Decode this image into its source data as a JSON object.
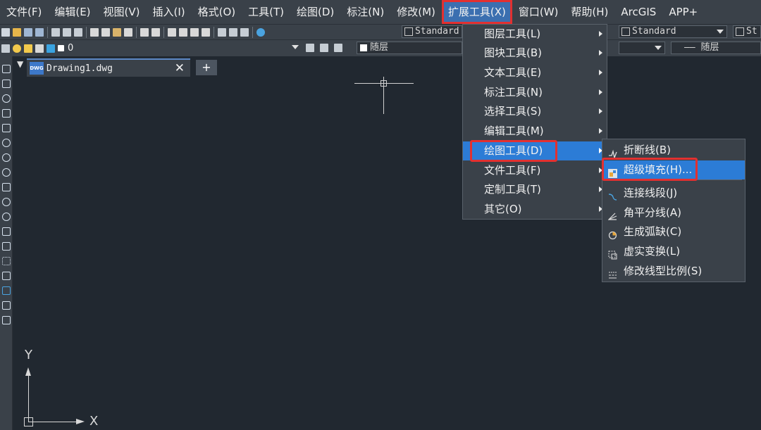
{
  "menubar": {
    "items": [
      "文件(F)",
      "编辑(E)",
      "视图(V)",
      "插入(I)",
      "格式(O)",
      "工具(T)",
      "绘图(D)",
      "标注(N)",
      "修改(M)",
      "扩展工具(X)",
      "窗口(W)",
      "帮助(H)",
      "ArcGIS",
      "APP+"
    ]
  },
  "toolbar": {
    "text_style": "Standard",
    "dim_style": "Standard",
    "dim_style_truncated": "St",
    "layer_value": "0",
    "color_value": "随层",
    "linetype_value": "—— 随层"
  },
  "document": {
    "tab_name": "Drawing1.dwg",
    "tab_icon_label": "DWG",
    "close_glyph": "✕",
    "new_tab_glyph": "+"
  },
  "ucs": {
    "x_label": "X",
    "y_label": "Y"
  },
  "ext_menu": {
    "items": [
      {
        "label": "图层工具(L)"
      },
      {
        "label": "图块工具(B)"
      },
      {
        "label": "文本工具(E)"
      },
      {
        "label": "标注工具(N)"
      },
      {
        "label": "选择工具(S)"
      },
      {
        "label": "编辑工具(M)"
      },
      {
        "label": "绘图工具(D)",
        "highlighted": true
      },
      {
        "label": "文件工具(F)"
      },
      {
        "label": "定制工具(T)"
      },
      {
        "label": "其它(O)"
      }
    ]
  },
  "draw_menu": {
    "items": [
      {
        "label": "折断线(B)",
        "icon": "break-line-icon"
      },
      {
        "label": "超级填充(H)...",
        "icon": "super-hatch-icon",
        "highlighted": true
      },
      {
        "label": "连接线段(J)",
        "icon": "join-lines-icon"
      },
      {
        "label": "角平分线(A)",
        "icon": "angle-bisector-icon"
      },
      {
        "label": "生成弧缺(C)",
        "icon": "arc-gap-icon"
      },
      {
        "label": "虚实变换(L)",
        "icon": "dash-solid-icon"
      },
      {
        "label": "修改线型比例(S)",
        "icon": "linetype-scale-icon"
      }
    ]
  },
  "colors": {
    "accent": "#2c7cd6",
    "annotation": "#e23030",
    "canvas": "#212830",
    "chrome": "#3a4149"
  }
}
